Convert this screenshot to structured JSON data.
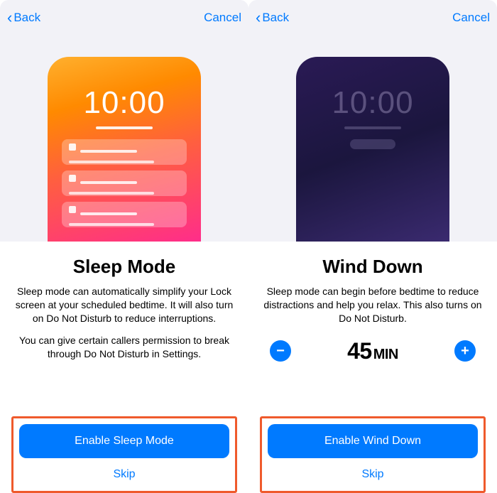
{
  "left": {
    "nav": {
      "back": "Back",
      "cancel": "Cancel"
    },
    "phone_time": "10:00",
    "title": "Sleep Mode",
    "desc1": "Sleep mode can automatically simplify your Lock screen at your scheduled bedtime. It will also turn on Do Not Disturb to reduce interruptions.",
    "desc2": "You can give certain callers permission to break through Do Not Disturb in Settings.",
    "primary": "Enable Sleep Mode",
    "skip": "Skip"
  },
  "right": {
    "nav": {
      "back": "Back",
      "cancel": "Cancel"
    },
    "phone_time": "10:00",
    "title": "Wind Down",
    "desc1": "Sleep mode can begin before bedtime to reduce distractions and help you relax. This also turns on Do Not Disturb.",
    "stepper": {
      "value": "45",
      "unit": "MIN"
    },
    "primary": "Enable Wind Down",
    "skip": "Skip"
  }
}
